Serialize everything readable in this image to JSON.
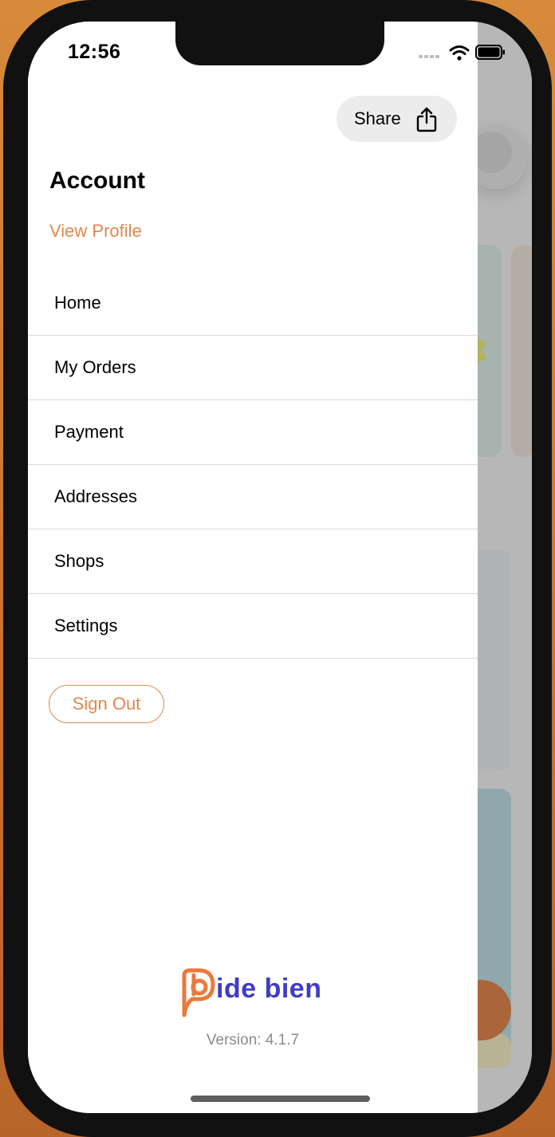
{
  "status_bar": {
    "time": "12:56"
  },
  "drawer": {
    "share_label": "Share",
    "account_title": "Account",
    "view_profile_label": "View Profile",
    "menu": [
      {
        "label": "Home"
      },
      {
        "label": "My Orders"
      },
      {
        "label": "Payment"
      },
      {
        "label": "Addresses"
      },
      {
        "label": "Shops"
      },
      {
        "label": "Settings"
      }
    ],
    "sign_out_label": "Sign Out",
    "logo_text": "ide bien",
    "version": "Version: 4.1.7"
  },
  "icons": {
    "share": "share-icon",
    "wifi": "wifi-icon",
    "battery": "battery-icon",
    "signal": "signal-icon",
    "logo": "pide-bien-logo"
  },
  "colors": {
    "accent": "#e0874f",
    "logo_blue": "#3f3cc4",
    "logo_orange": "#ea7a3c",
    "divider": "#d9d9d9"
  }
}
